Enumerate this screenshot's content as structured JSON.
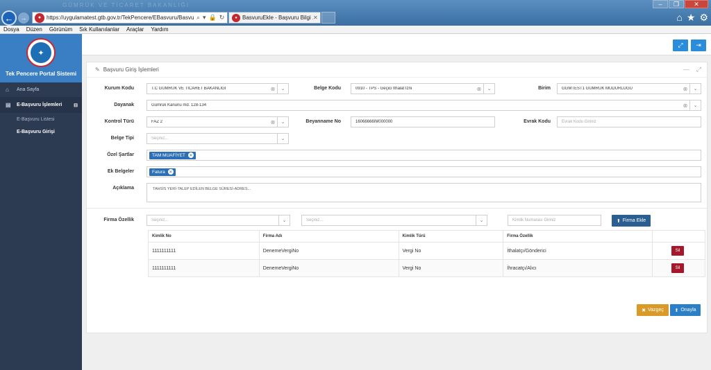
{
  "browser": {
    "ghost_text": "GÜMRÜK VE TİCARET BAKANLIĞI",
    "url": "https://uygulamatest.gtb.gov.tr/TekPencere/EBasvuru/Basvu",
    "tab_title": "BasvuruEkle - Başvuru Bilgi ...",
    "menu": [
      "Dosya",
      "Düzen",
      "Görünüm",
      "Sık Kullanılanlar",
      "Araçlar",
      "Yardım"
    ]
  },
  "sidebar": {
    "title": "Tek Pencere Portal Sistemi",
    "home": "Ana Sayfa",
    "group": "E-Başvuru İşlemleri",
    "items": [
      "E-Başvuru Listesi",
      "E-Başvuru Girişi"
    ]
  },
  "panel": {
    "title": "Başvuru Giriş İşlemleri"
  },
  "form": {
    "kurum_kodu_label": "Kurum Kodu",
    "kurum_kodu_value": "T.C GÜMRÜK VE TİCARET BAKANLIĞI",
    "belge_kodu_label": "Belge Kodu",
    "belge_kodu_value": "0910 - TPS - Geçici İthalat İzni",
    "birim_label": "Birim",
    "birim_value": "GGMTEST1 GÜMRÜK MÜDÜRLÜĞÜ",
    "dayanak_label": "Dayanak",
    "dayanak_value": "Gümrük Kanunu md. 128-134",
    "kontrol_turu_label": "Kontrol Türü",
    "kontrol_turu_value": "FAZ 2",
    "beyanname_label": "Beyanname No",
    "beyanname_value": "16066666IM000000",
    "evrak_kodu_label": "Evrak Kodu",
    "evrak_kodu_placeholder": "Evrak Kodu Giriniz",
    "belge_tipi_label": "Belge Tipi",
    "belge_tipi_placeholder": "Seçiniz...",
    "ozel_sartlar_label": "Özel Şartlar",
    "ozel_sartlar_tag": "TAM MUAFİYET",
    "ek_belgeler_label": "Ek Belgeler",
    "ek_belgeler_tag": "Fatura",
    "aciklama_label": "Açıklama",
    "aciklama_value": "TAHSİS YERİ-TALEP EDİLEN BELGE SÜRESİ-ADRES..."
  },
  "firma": {
    "label": "Firma Özellik",
    "select1_placeholder": "Seçiniz...",
    "select2_placeholder": "Seçiniz...",
    "kimlik_placeholder": "Kimlik Numarası Giriniz",
    "add_button": "Firma Ekle",
    "columns": [
      "Kimlik No",
      "Firma Adı",
      "Kimlik Türü",
      "Firma Özellik"
    ],
    "rows": [
      {
        "kimlik_no": "1111111111",
        "firma_adi": "DenemeVergiNo",
        "kimlik_turu": "Vergi No",
        "ozellik": "İthalatçı/Gönderici",
        "action": "Sil"
      },
      {
        "kimlik_no": "1111111111",
        "firma_adi": "DenemeVergiNo",
        "kimlik_turu": "Vergi No",
        "ozellik": "İhracatçı/Alıcı",
        "action": "Sil"
      }
    ]
  },
  "actions": {
    "cancel": "Vazgeç",
    "approve": "Onayla"
  }
}
